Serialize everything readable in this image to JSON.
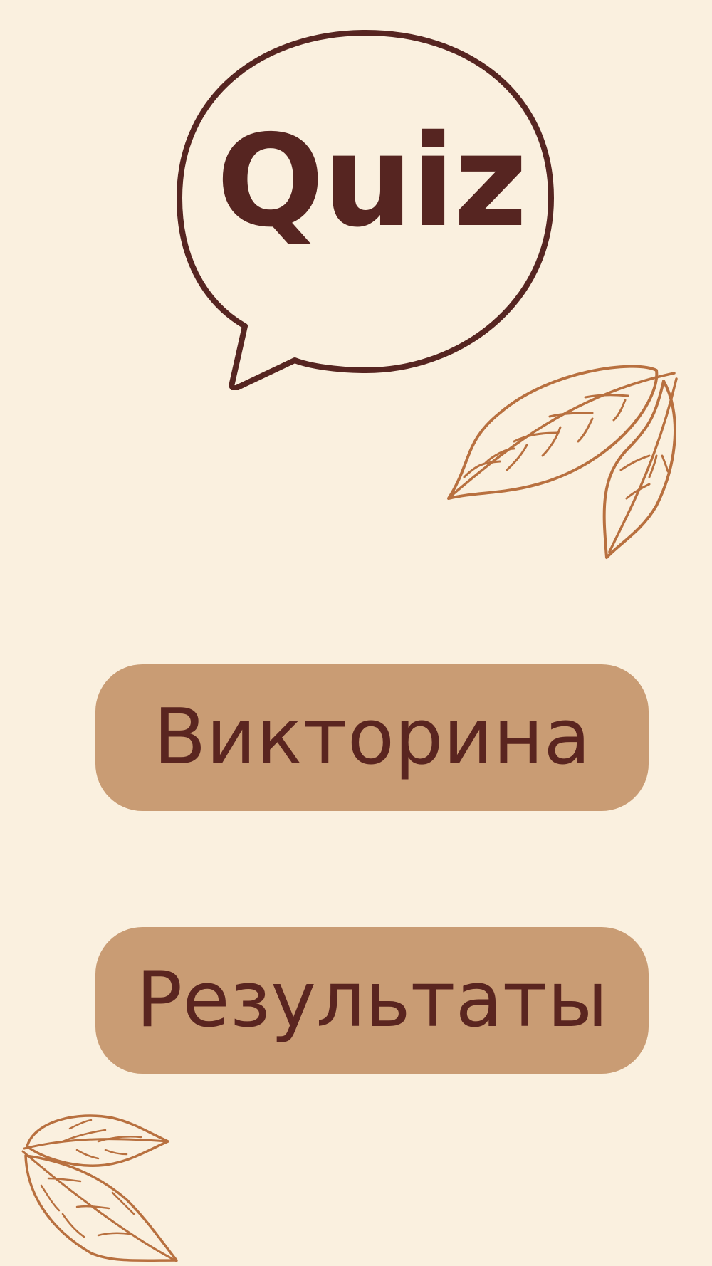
{
  "logo": {
    "text": "Quiz",
    "icon": "speech-bubble-icon",
    "color": "#562521"
  },
  "menu": {
    "quiz_label": "Викторина",
    "results_label": "Результаты"
  },
  "decorations": {
    "top_right": "leaves-icon",
    "bottom_left": "leaves-icon",
    "leaf_color": "#B8703F"
  },
  "colors": {
    "background": "#FAF0DF",
    "button": "#C99C74",
    "button_text": "#5A2520"
  }
}
